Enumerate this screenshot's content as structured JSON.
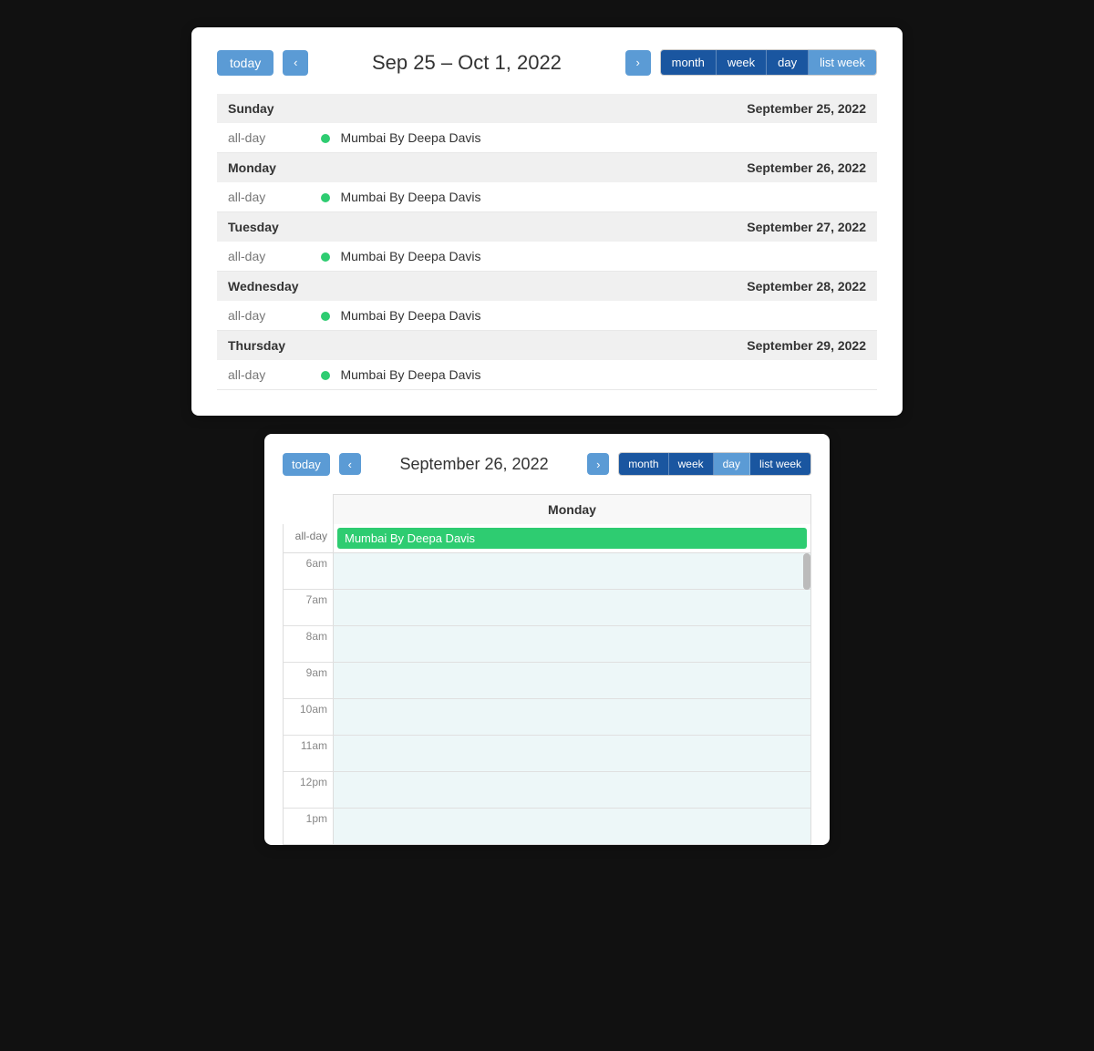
{
  "top_calendar": {
    "today_label": "today",
    "nav_prev": "‹",
    "nav_next": "›",
    "title": "Sep 25 – Oct 1, 2022",
    "views": [
      "month",
      "week",
      "day",
      "list week"
    ],
    "active_view": "list week",
    "days": [
      {
        "day_name": "Sunday",
        "day_date": "September 25, 2022",
        "events": [
          {
            "time": "all-day",
            "dot_color": "#2ecc71",
            "title": "Mumbai By Deepa Davis"
          }
        ]
      },
      {
        "day_name": "Monday",
        "day_date": "September 26, 2022",
        "events": [
          {
            "time": "all-day",
            "dot_color": "#2ecc71",
            "title": "Mumbai By Deepa Davis"
          }
        ]
      },
      {
        "day_name": "Tuesday",
        "day_date": "September 27, 2022",
        "events": [
          {
            "time": "all-day",
            "dot_color": "#2ecc71",
            "title": "Mumbai By Deepa Davis"
          }
        ]
      },
      {
        "day_name": "Wednesday",
        "day_date": "September 28, 2022",
        "events": [
          {
            "time": "all-day",
            "dot_color": "#2ecc71",
            "title": "Mumbai By Deepa Davis"
          }
        ]
      },
      {
        "day_name": "Thursday",
        "day_date": "September 29, 2022",
        "events": [
          {
            "time": "all-day",
            "dot_color": "#2ecc71",
            "title": "Mumbai By Deepa Davis"
          }
        ]
      }
    ]
  },
  "bottom_calendar": {
    "today_label": "today",
    "nav_prev": "‹",
    "nav_next": "›",
    "title": "September 26, 2022",
    "views": [
      "month",
      "week",
      "day",
      "list week"
    ],
    "active_view": "day",
    "day_column_header": "Monday",
    "allday_label": "all-day",
    "allday_event": "Mumbai By Deepa Davis",
    "time_slots": [
      "6am",
      "7am",
      "8am",
      "9am",
      "10am",
      "11am",
      "12pm",
      "1pm"
    ]
  }
}
